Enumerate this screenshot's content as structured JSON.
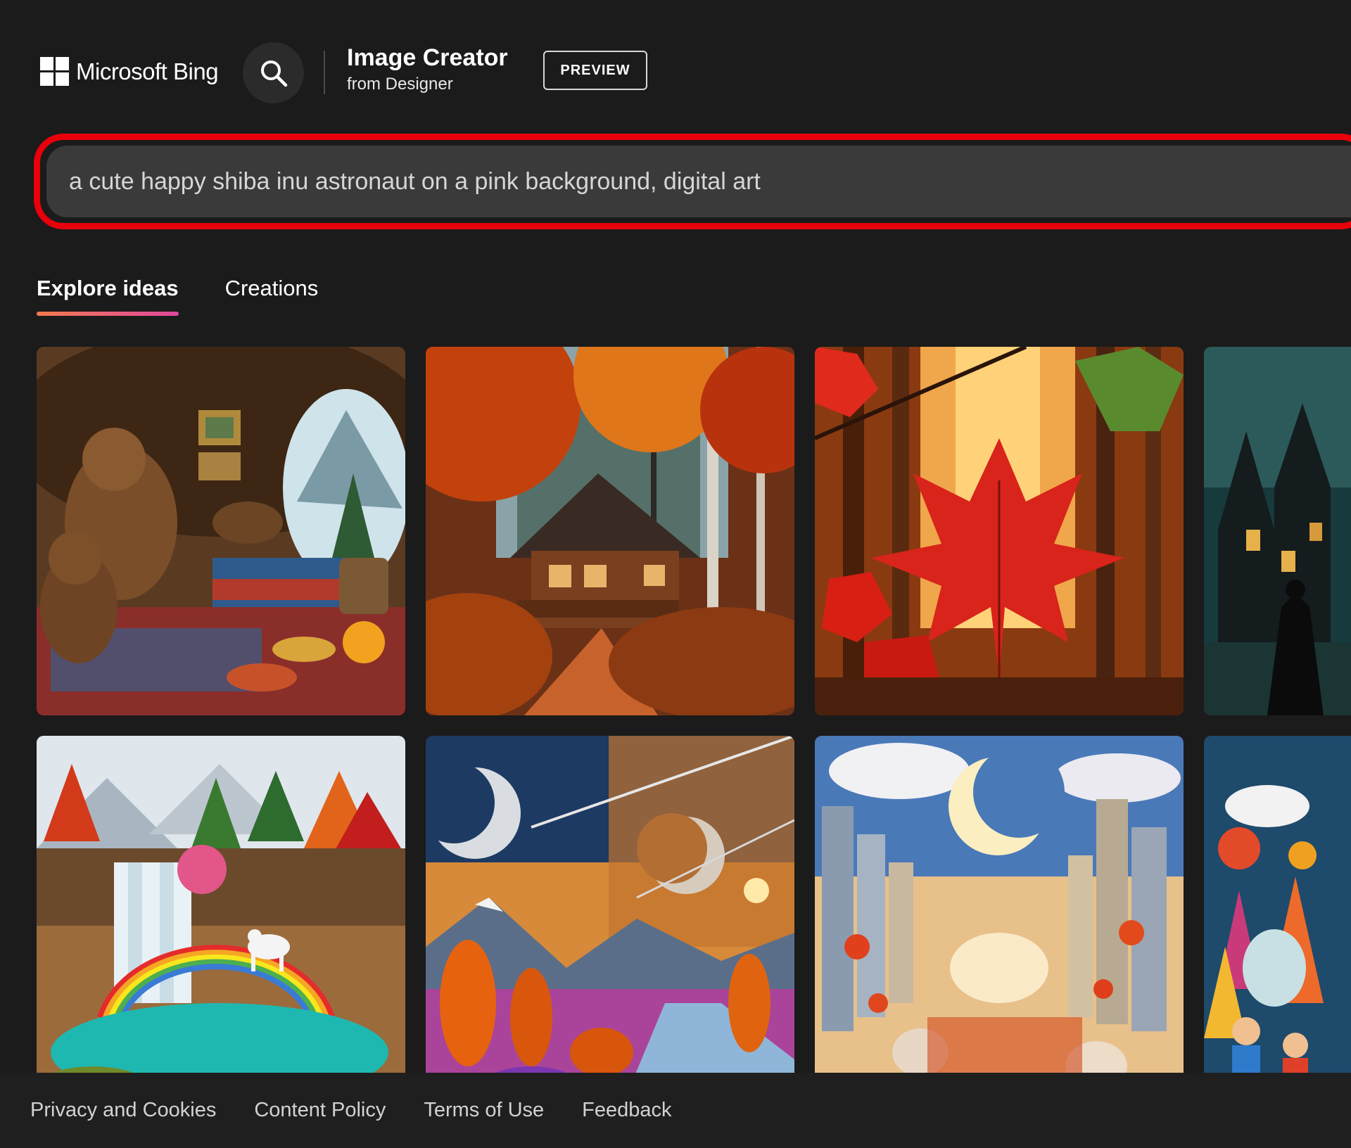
{
  "header": {
    "brand": "Microsoft Bing",
    "app_title": "Image Creator",
    "app_subtitle": "from Designer",
    "badge": "PREVIEW"
  },
  "prompt": {
    "value": "a cute happy shiba inu astronaut on a pink background, digital art",
    "highlight_color": "#e8000b"
  },
  "tabs": [
    {
      "label": "Explore ideas",
      "active": true
    },
    {
      "label": "Creations",
      "active": false
    }
  ],
  "gallery": {
    "images": [
      {
        "subject": "bears-in-cozy-cave"
      },
      {
        "subject": "autumn-forest-cabin"
      },
      {
        "subject": "red-maple-leaf"
      },
      {
        "subject": "dark-gothic-castle"
      },
      {
        "subject": "waterfall-rainbow-unicorn"
      },
      {
        "subject": "moons-autumn-valley"
      },
      {
        "subject": "moon-city-lanterns"
      },
      {
        "subject": "colorful-felt-village"
      }
    ]
  },
  "footer": {
    "links": [
      "Privacy and Cookies",
      "Content Policy",
      "Terms of Use",
      "Feedback"
    ]
  },
  "icons": {
    "search": "search-icon",
    "logo": "microsoft-logo-icon"
  }
}
